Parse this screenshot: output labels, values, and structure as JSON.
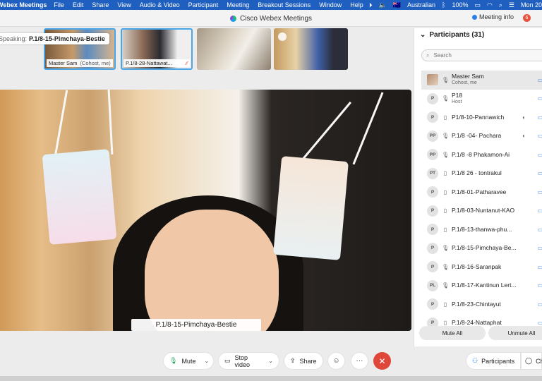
{
  "menubar": {
    "app_name": "Webex Meetings",
    "items": [
      "File",
      "Edit",
      "Share",
      "View",
      "Audio & Video",
      "Participant",
      "Meeting",
      "Breakout Sessions",
      "Window",
      "Help"
    ],
    "battery": "100%",
    "keyboard": "Australian",
    "clock": "Mon 20"
  },
  "window": {
    "title": "Cisco Webex Meetings",
    "meeting_info": "Meeting info",
    "notifications": "6"
  },
  "speaking": {
    "label": "Speaking:",
    "name": "P.1/8-15-Pimchaya-Bestie"
  },
  "thumbnails": [
    {
      "name": "Master Sam",
      "sub": "(Cohost, me)"
    },
    {
      "name": "P.1/8-28-Nattawat...",
      "sub": ""
    },
    {
      "name": "",
      "sub": ""
    },
    {
      "name": "",
      "sub": ""
    }
  ],
  "main_video": {
    "name": "P.1/8-15-Pimchaya-Bestie"
  },
  "participants": {
    "header": "Participants (31)",
    "search_placeholder": "Search",
    "list": [
      {
        "initials": "",
        "name": "Master Sam",
        "role": "Cohost, me",
        "device": "🎙",
        "extra": ""
      },
      {
        "initials": "P",
        "name": "P18",
        "role": "Host",
        "device": "🎙",
        "extra": ""
      },
      {
        "initials": "P",
        "name": "P1/8-10-Pannawich",
        "role": "",
        "device": "▯",
        "extra": "◐"
      },
      {
        "initials": "PP",
        "name": "P.1/8 -04- Pachara",
        "role": "",
        "device": "🎙",
        "extra": "◐"
      },
      {
        "initials": "PP",
        "name": "P.1/8 -8 Phakamon-Ai",
        "role": "",
        "device": "🎙",
        "extra": ""
      },
      {
        "initials": "PT",
        "name": "P.1/8 26 - tontrakul",
        "role": "",
        "device": "▯",
        "extra": ""
      },
      {
        "initials": "P",
        "name": "P.1/8-01-Patharavee",
        "role": "",
        "device": "▯",
        "extra": ""
      },
      {
        "initials": "P",
        "name": "P.1/8-03-Nuntanut-KAO",
        "role": "",
        "device": "▯",
        "extra": ""
      },
      {
        "initials": "P",
        "name": "P.1/8-13-thanwa-phu...",
        "role": "",
        "device": "▯",
        "extra": ""
      },
      {
        "initials": "P",
        "name": "P.1/8-15-Pimchaya-Be...",
        "role": "",
        "device": "🎙",
        "extra": ""
      },
      {
        "initials": "P",
        "name": "P.1/8-16-Saranpak",
        "role": "",
        "device": "🎙",
        "extra": ""
      },
      {
        "initials": "PL",
        "name": "P.1/8-17-Kantinun Lert...",
        "role": "",
        "device": "🎙",
        "extra": ""
      },
      {
        "initials": "P",
        "name": "P.1/8-23-Chintayut",
        "role": "",
        "device": "▯",
        "extra": ""
      },
      {
        "initials": "P",
        "name": "P.1/8-24-Nattaphat",
        "role": "",
        "device": "▯",
        "extra": ""
      }
    ],
    "mute_all": "Mute All",
    "unmute_all": "Unmute All"
  },
  "controls": {
    "mute": "Mute",
    "stop_video": "Stop video",
    "share": "Share",
    "participants_tab": "Participants",
    "chat_tab": "Ch"
  },
  "colors": {
    "menubar": "#1f5fbf",
    "accent": "#2b7de9",
    "leave": "#e0473b"
  }
}
